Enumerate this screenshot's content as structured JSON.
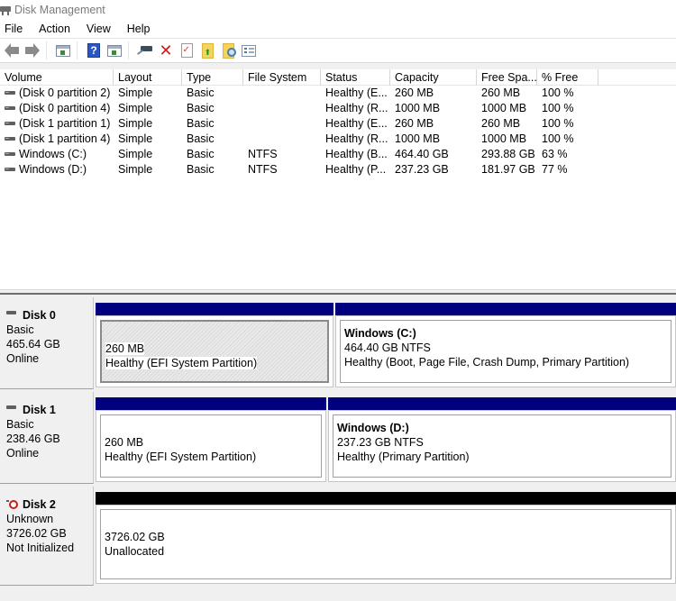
{
  "window": {
    "title": "Disk Management"
  },
  "menu": [
    "File",
    "Action",
    "View",
    "Help"
  ],
  "toolbar": {
    "buttons": [
      {
        "name": "back",
        "icon": "back-arrow-icon"
      },
      {
        "name": "forward",
        "icon": "forward-arrow-icon"
      },
      {
        "name": "show-hide-console-tree",
        "icon": "console-tree-icon"
      },
      {
        "name": "help",
        "icon": "help-icon",
        "glyph": "?"
      },
      {
        "name": "show-hide-action-pane",
        "icon": "action-pane-icon"
      },
      {
        "name": "connect-virtual-disk",
        "icon": "connect-disk-icon"
      },
      {
        "name": "delete",
        "icon": "delete-icon",
        "glyph": "✕"
      },
      {
        "name": "properties",
        "icon": "properties-icon"
      },
      {
        "name": "open",
        "icon": "folder-up-icon"
      },
      {
        "name": "explore",
        "icon": "folder-search-icon"
      },
      {
        "name": "settings-list",
        "icon": "list-view-icon"
      }
    ]
  },
  "volume_list": {
    "columns": [
      "Volume",
      "Layout",
      "Type",
      "File System",
      "Status",
      "Capacity",
      "Free Spa...",
      "% Free",
      ""
    ],
    "rows": [
      {
        "volume": "(Disk 0 partition 2)",
        "layout": "Simple",
        "type": "Basic",
        "fs": "",
        "status": "Healthy (E...",
        "capacity": "260 MB",
        "free": "260 MB",
        "pct": "100 %"
      },
      {
        "volume": "(Disk 0 partition 4)",
        "layout": "Simple",
        "type": "Basic",
        "fs": "",
        "status": "Healthy (R...",
        "capacity": "1000 MB",
        "free": "1000 MB",
        "pct": "100 %"
      },
      {
        "volume": "(Disk 1 partition 1)",
        "layout": "Simple",
        "type": "Basic",
        "fs": "",
        "status": "Healthy (E...",
        "capacity": "260 MB",
        "free": "260 MB",
        "pct": "100 %"
      },
      {
        "volume": "(Disk 1 partition 4)",
        "layout": "Simple",
        "type": "Basic",
        "fs": "",
        "status": "Healthy (R...",
        "capacity": "1000 MB",
        "free": "1000 MB",
        "pct": "100 %"
      },
      {
        "volume": "Windows (C:)",
        "layout": "Simple",
        "type": "Basic",
        "fs": "NTFS",
        "status": "Healthy (B...",
        "capacity": "464.40 GB",
        "free": "293.88 GB",
        "pct": "63 %"
      },
      {
        "volume": "Windows (D:)",
        "layout": "Simple",
        "type": "Basic",
        "fs": "NTFS",
        "status": "Healthy (P...",
        "capacity": "237.23 GB",
        "free": "181.97 GB",
        "pct": "77 %"
      }
    ]
  },
  "disks": [
    {
      "name": "Disk 0",
      "type": "Basic",
      "size": "465.64 GB",
      "state": "Online",
      "icon": "disk-icon",
      "partitions": [
        {
          "title": "",
          "line1": "260 MB",
          "line2": "Healthy (EFI System Partition)",
          "selected": true,
          "bar": "#00007f"
        },
        {
          "title": "Windows  (C:)",
          "line1": "464.40 GB NTFS",
          "line2": "Healthy (Boot, Page File, Crash Dump, Primary Partition)",
          "selected": false,
          "bar": "#00007f"
        }
      ]
    },
    {
      "name": "Disk 1",
      "type": "Basic",
      "size": "238.46 GB",
      "state": "Online",
      "icon": "disk-icon",
      "partitions": [
        {
          "title": "",
          "line1": "260 MB",
          "line2": "Healthy (EFI System Partition)",
          "selected": false,
          "bar": "#00007f"
        },
        {
          "title": "Windows  (D:)",
          "line1": "237.23 GB NTFS",
          "line2": "Healthy (Primary Partition)",
          "selected": false,
          "bar": "#00007f"
        }
      ]
    },
    {
      "name": "Disk 2",
      "type": "Unknown",
      "size": "3726.02 GB",
      "state": "Not Initialized",
      "icon": "disk-error-icon",
      "partitions": [
        {
          "title": "",
          "line1": "3726.02 GB",
          "line2": "Unallocated",
          "selected": false,
          "bar": "#000000"
        }
      ]
    }
  ]
}
